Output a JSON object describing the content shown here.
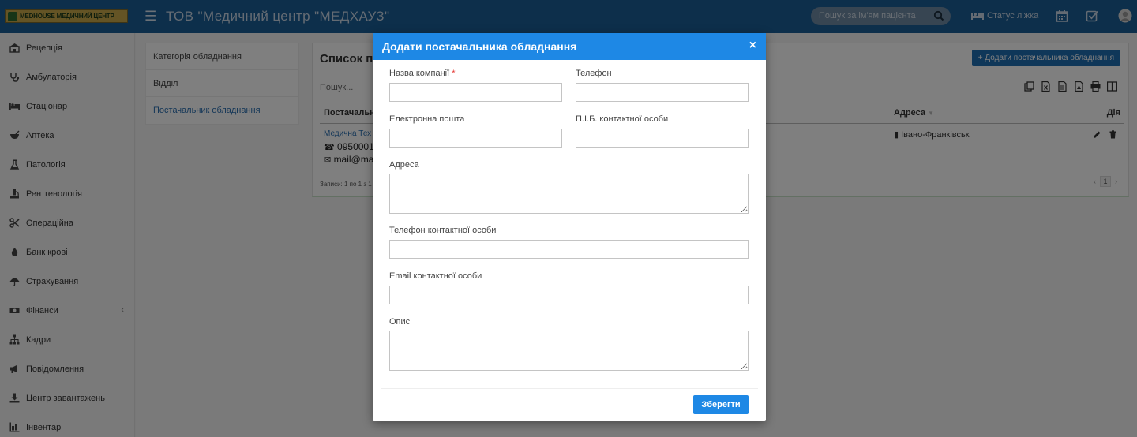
{
  "header": {
    "logo_text": "MEDHOUSE МЕДИЧНИЙ ЦЕНТР",
    "title": "ТОВ \"Медичний центр \"МЕДХАУЗ\"",
    "search_placeholder": "Пошук за ім'ям пацієнта",
    "bed_status_label": "Статус ліжка",
    "icons": [
      "menu-icon",
      "search-icon",
      "bed-icon",
      "calendar-icon",
      "checkbox-icon",
      "user-avatar-icon"
    ]
  },
  "sidebar": {
    "items": [
      {
        "label": "Рецепція",
        "icon": "reception-icon"
      },
      {
        "label": "Амбулаторія",
        "icon": "stethoscope-icon"
      },
      {
        "label": "Стаціонар",
        "icon": "bed-icon"
      },
      {
        "label": "Аптека",
        "icon": "pharmacy-icon"
      },
      {
        "label": "Патологія",
        "icon": "flask-icon"
      },
      {
        "label": "Рентгенологія",
        "icon": "xray-icon"
      },
      {
        "label": "Операційна",
        "icon": "scissors-icon"
      },
      {
        "label": "Банк крові",
        "icon": "blood-drop-icon"
      },
      {
        "label": "Страхування",
        "icon": "umbrella-icon"
      },
      {
        "label": "Фінанси",
        "icon": "money-icon",
        "has_submenu": true
      },
      {
        "label": "Кадри",
        "icon": "org-chart-icon"
      },
      {
        "label": "Повідомлення",
        "icon": "bullhorn-icon"
      },
      {
        "label": "Центр завантажень",
        "icon": "download-icon"
      },
      {
        "label": "Інвентар",
        "icon": "inventory-icon"
      }
    ]
  },
  "subnav": {
    "items": [
      {
        "label": "Категорія обладнання",
        "active": false
      },
      {
        "label": "Відділ",
        "active": false
      },
      {
        "label": "Постачальник обладнання",
        "active": true
      }
    ]
  },
  "panel": {
    "title": "Список по",
    "add_button": "+ Додати постачальника обладнання",
    "search_placeholder": "Пошук...",
    "columns": {
      "supplier": "Постачальн",
      "address": "Адреса",
      "actions": "Дія"
    },
    "row": {
      "name": "Медична Тех",
      "phone": "09500011",
      "email": "mail@ma",
      "address": "Івано-Франківськ"
    },
    "records_info": "Записи: 1 по 1 з 1",
    "page": "1"
  },
  "modal": {
    "title": "Додати постачальника обладнання",
    "close": "×",
    "fields": {
      "company_name": {
        "label": "Назва компанії",
        "required_mark": "*",
        "value": ""
      },
      "phone": {
        "label": "Телефон",
        "value": ""
      },
      "email": {
        "label": "Електронна пошта",
        "value": ""
      },
      "contact_person": {
        "label": "П.І.Б. контактної особи",
        "value": ""
      },
      "address": {
        "label": "Адреса",
        "value": ""
      },
      "contact_phone": {
        "label": "Телефон контактної особи",
        "value": ""
      },
      "contact_email": {
        "label": "Email контактної особи",
        "value": ""
      },
      "description": {
        "label": "Опис",
        "value": ""
      }
    },
    "save_button": "Зберегти"
  },
  "colors": {
    "header_bg": "#1b5e96",
    "modal_header": "#1e88e5",
    "primary_button": "#1e88e5",
    "link": "#2a6fb0",
    "required": "#e53935"
  }
}
